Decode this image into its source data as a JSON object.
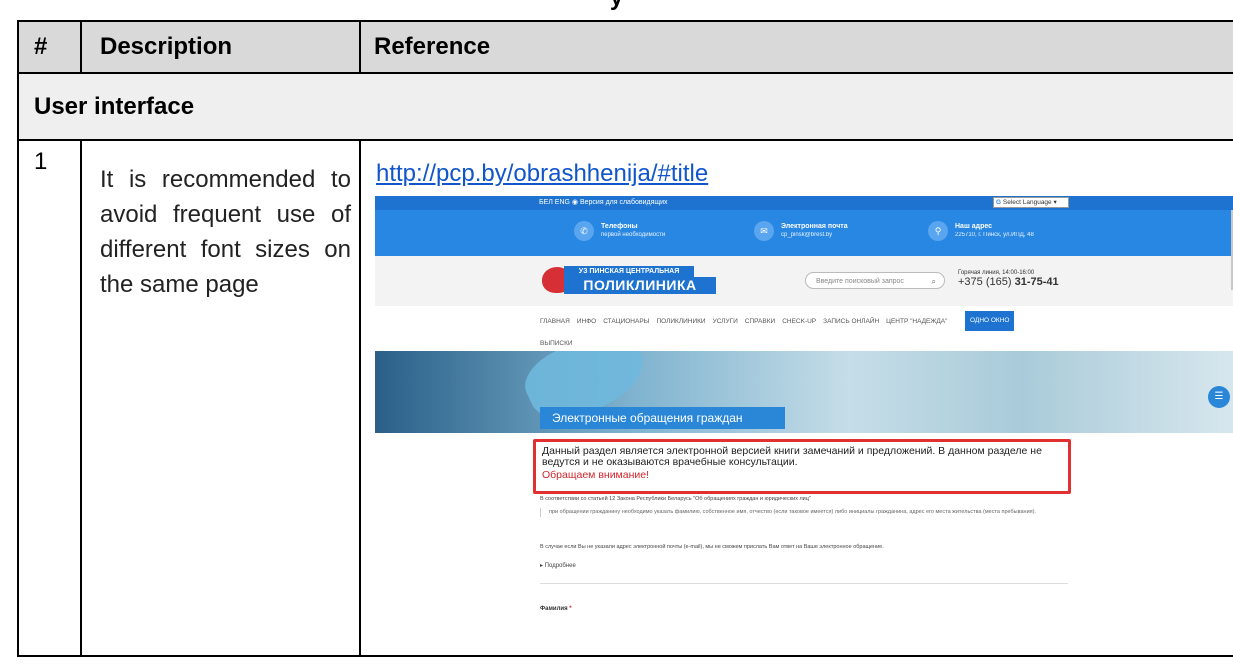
{
  "table": {
    "headers": {
      "num": "#",
      "description": "Description",
      "reference": "Reference"
    },
    "section": "User interface",
    "rows": [
      {
        "num": "1",
        "description": "It is recommended to avoid frequent use of different font sizes on the same page",
        "reference_url": "http://pcp.by/obrashhenija/#title"
      }
    ]
  },
  "screenshot": {
    "topbar": {
      "lang": "БЕЛ ENG ◉ Версия для слабовидящих",
      "translate": "Select Language"
    },
    "contacts": [
      {
        "title": "Телефоны",
        "sub": "первой необходимости",
        "icon": "phone-icon"
      },
      {
        "title": "Электронная почта",
        "sub": "cp_pinsk@brest.by",
        "icon": "mail-icon"
      },
      {
        "title": "Наш адрес",
        "sub": "225710, г. Пинск, ул.ИПД, 48",
        "icon": "location-icon"
      }
    ],
    "logo": {
      "line1": "УЗ ПИНСКАЯ ЦЕНТРАЛЬНАЯ",
      "line2": "ПОЛИКЛИНИКА"
    },
    "search_placeholder": "Введите поисковый запрос",
    "hotline": {
      "label": "Горячая линия, 14:00-16:00",
      "prefix": "+375 (165) ",
      "number": "31-75-41"
    },
    "nav": {
      "items": [
        "ГЛАВНАЯ",
        "ИНФО",
        "СТАЦИОНАРЫ",
        "ПОЛИКЛИНИКИ",
        "УСЛУГИ",
        "СПРАВКИ",
        "CHECK-UP",
        "ЗАПИСЬ ОНЛАЙН",
        "ЦЕНТР \"НАДЕЖДА\""
      ],
      "active": "ОДНО ОКНО",
      "second_line": "ВЫПИСКИ"
    },
    "hero_title": "Электронные обращения граждан",
    "notice": {
      "text": "Данный раздел является электронной версией книги замечаний и предложений. В данном разделе не ведутся и не оказываются врачебные консультации.",
      "warning": "Обращаем внимание!"
    },
    "law": "В соответствии со статьей 12 Закона Республики Беларусь \"Об обращениях граждан и юридических лиц\"",
    "quote": "при обращении гражданину необходимо указать фамилию, собственное имя, отчество (если таковое имеется) либо инициалы гражданина, адрес его места жительства (места пребывания).",
    "email_note": "В случае если Вы не указали адрес электронной почты (e-mail), мы не сможем прислать Вам ответ на Ваше электронное обращение.",
    "more": "▸ Подробнее",
    "surname_label": "Фамилия",
    "surname_req": "*"
  }
}
